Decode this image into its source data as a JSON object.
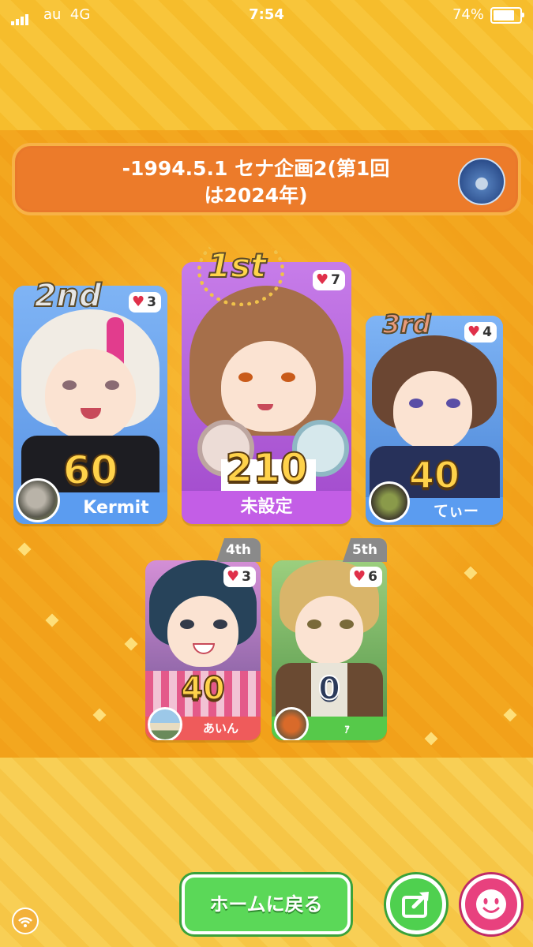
{
  "status_bar": {
    "carrier": "au",
    "network": "4G",
    "time": "7:54",
    "battery": "74%"
  },
  "title": {
    "line1": "-1994.5.1 セナ企画2(第1回",
    "line2": "は2024年)"
  },
  "ranking": [
    {
      "rank_label": "1st",
      "likes": "7",
      "score": "210",
      "name": "未設定",
      "color": "#c35ee6"
    },
    {
      "rank_label": "2nd",
      "likes": "3",
      "score": "60",
      "name": "Kermit",
      "color": "#5b9cf0"
    },
    {
      "rank_label": "3rd",
      "likes": "4",
      "score": "40",
      "name": "てぃー",
      "color": "#5b9cf0"
    },
    {
      "rank_label": "4th",
      "likes": "3",
      "score": "40",
      "name": "あいん",
      "color": "#ef5b5b"
    },
    {
      "rank_label": "5th",
      "likes": "6",
      "score": "0",
      "name": "ｧ",
      "color": "#56c94a"
    }
  ],
  "buttons": {
    "home": "ホームに戻る"
  },
  "icons": {
    "share": "share-icon",
    "emote": "smiley-icon",
    "heart": "heart-icon",
    "connection": "wifi-icon"
  }
}
